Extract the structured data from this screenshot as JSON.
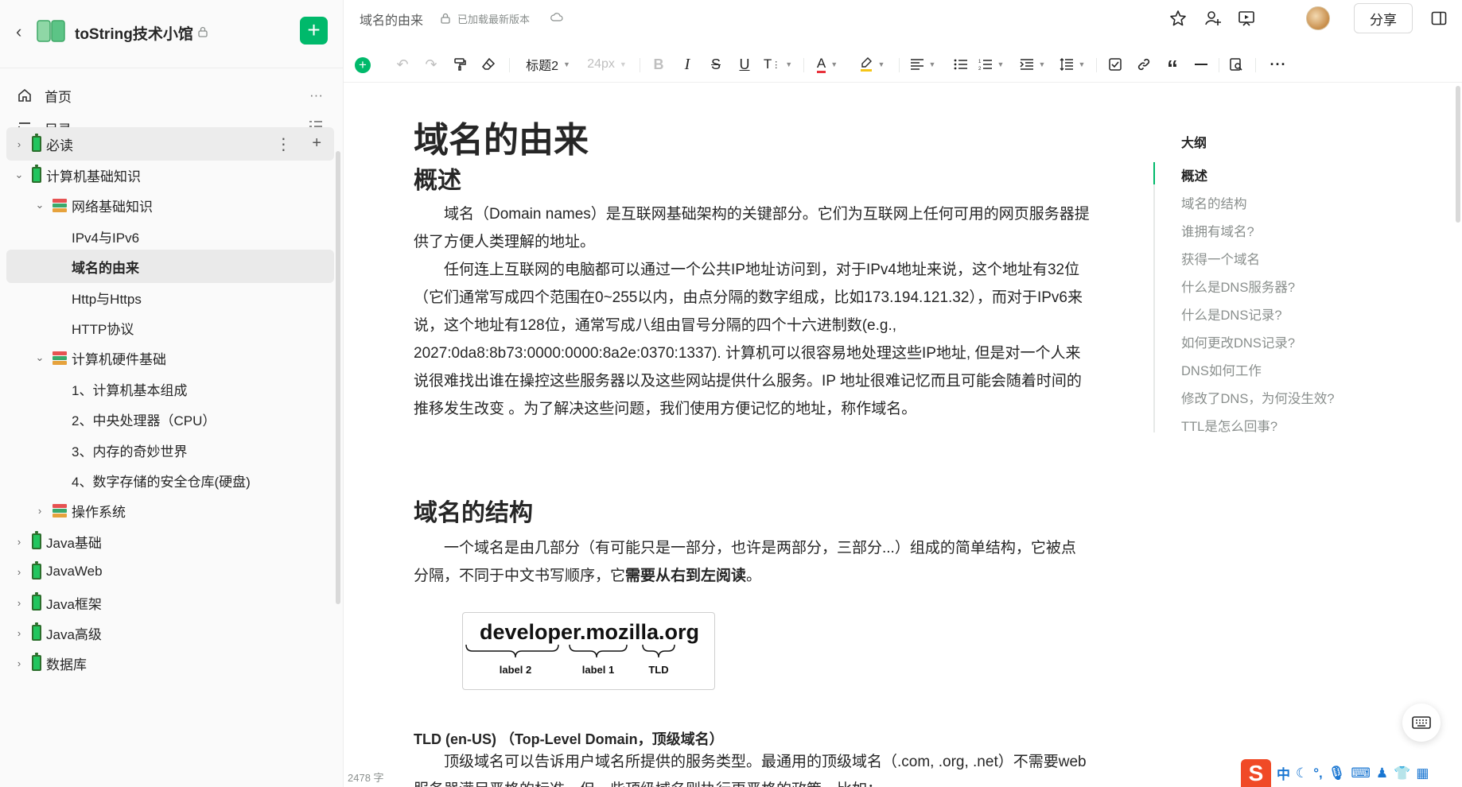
{
  "sidebar": {
    "book_title": "toString技术小馆",
    "nav": [
      {
        "label": "首页",
        "icon": "home-icon"
      },
      {
        "label": "目录",
        "icon": "toc-icon"
      }
    ],
    "tree": [
      {
        "label": "必读",
        "level": 0,
        "expanded": false,
        "icon": "battery-icon"
      },
      {
        "label": "计算机基础知识",
        "level": 0,
        "expanded": true,
        "icon": "battery-icon"
      },
      {
        "label": "网络基础知识",
        "level": 1,
        "expanded": true,
        "icon": "books-icon"
      },
      {
        "label": "IPv4与IPv6",
        "level": 2
      },
      {
        "label": "域名的由来",
        "level": 2,
        "current": true
      },
      {
        "label": "Http与Https",
        "level": 2
      },
      {
        "label": "HTTP协议",
        "level": 2
      },
      {
        "label": "计算机硬件基础",
        "level": 1,
        "expanded": true,
        "icon": "books-icon"
      },
      {
        "label": "1、计算机基本组成",
        "level": 2
      },
      {
        "label": "2、中央处理器（CPU）",
        "level": 2
      },
      {
        "label": "3、内存的奇妙世界",
        "level": 2
      },
      {
        "label": "4、数字存储的安全仓库(硬盘)",
        "level": 2
      },
      {
        "label": "操作系统",
        "level": 1,
        "expanded": false,
        "icon": "books-icon"
      },
      {
        "label": "Java基础",
        "level": 0,
        "expanded": false,
        "icon": "battery-icon"
      },
      {
        "label": "JavaWeb",
        "level": 0,
        "expanded": false,
        "icon": "battery-icon"
      },
      {
        "label": "Java框架",
        "level": 0,
        "expanded": false,
        "icon": "battery-icon"
      },
      {
        "label": "Java高级",
        "level": 0,
        "expanded": false,
        "icon": "battery-icon"
      },
      {
        "label": "数据库",
        "level": 0,
        "expanded": false,
        "icon": "battery-icon"
      }
    ]
  },
  "topbar": {
    "doc_name": "域名的由来",
    "status": "已加载最新版本",
    "share_label": "分享"
  },
  "toolbar": {
    "heading_style": "标题2",
    "font_size": "24px"
  },
  "doc": {
    "title": "域名的由来",
    "section1": {
      "heading": "概述",
      "p1": "域名（Domain names）是互联网基础架构的关键部分。它们为互联网上任何可用的网页服务器提供了方便人类理解的地址。",
      "p2": "任何连上互联网的电脑都可以通过一个公共IP地址访问到，对于IPv4地址来说，这个地址有32位（它们通常写成四个范围在0~255以内，由点分隔的数字组成，比如173.194.121.32），而对于IPv6来说，这个地址有128位，通常写成八组由冒号分隔的四个十六进制数(e.g., 2027:0da8:8b73:0000:0000:8a2e:0370:1337). 计算机可以很容易地处理这些IP地址, 但是对一个人来说很难找出谁在操控这些服务器以及这些网站提供什么服务。IP 地址很难记忆而且可能会随着时间的推移发生改变 。为了解决这些问题，我们使用方便记忆的地址，称作域名。"
    },
    "section2": {
      "heading": "域名的结构",
      "p1_plain": "一个域名是由几部分（有可能只是一部分，也许是两部分，三部分...）组成的简单结构，它被点分隔，不同于中文书写顺序，它",
      "p1_bold": "需要从右到左阅读",
      "p1_end": "。"
    },
    "figure": {
      "domain": "developer.mozilla.org",
      "labels": [
        "label 2",
        "label 1",
        "TLD"
      ]
    },
    "tld": {
      "heading": "TLD (en-US) （Top-Level Domain，顶级域名）",
      "p1": "顶级域名可以告诉用户域名所提供的服务类型。最通用的顶级域名（.com, .org, .net）不需要web服务器满足严格的标准，但一些顶级域名则执行更严格的政策。比如："
    }
  },
  "outline": {
    "title": "大纲",
    "items": [
      "概述",
      "域名的结构",
      "谁拥有域名?",
      "获得一个域名",
      "什么是DNS服务器?",
      "什么是DNS记录?",
      "如何更改DNS记录?",
      "DNS如何工作",
      "修改了DNS，为何没生效?",
      "TTL是怎么回事?"
    ],
    "active_index": 0
  },
  "footer": {
    "word_count": "2478 字"
  },
  "ime": {
    "logo": "S",
    "mode": "中"
  },
  "colors": {
    "accent": "#00b96b",
    "battery": "#22c55e"
  }
}
